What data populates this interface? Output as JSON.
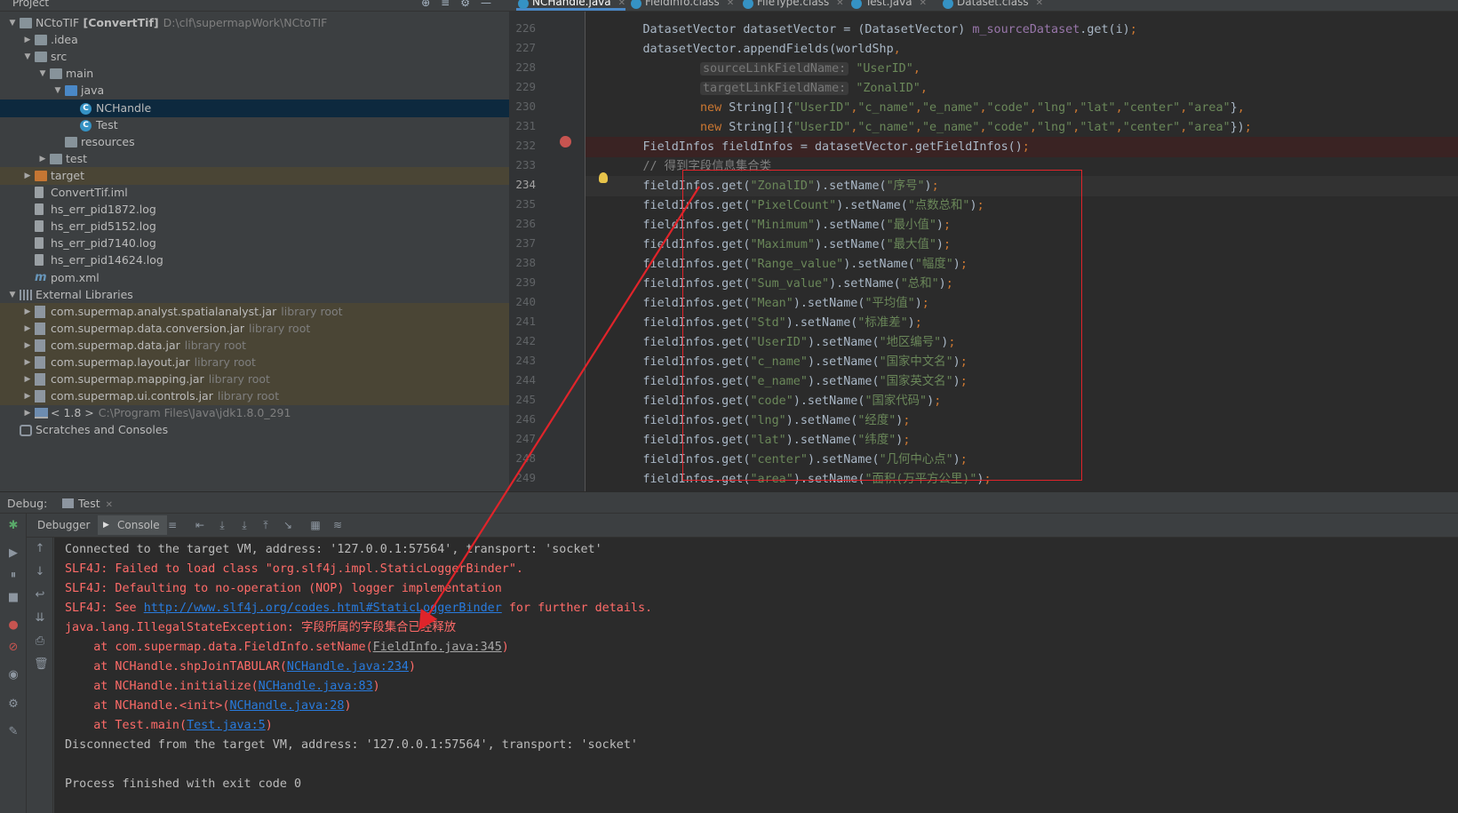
{
  "project": {
    "title": "Project",
    "tree": [
      {
        "depth": 0,
        "arrow": "▼",
        "icon": "folder",
        "label": "NCtoTIF",
        "bold_suffix": "[ConvertTif]",
        "hint": "D:\\clf\\supermapWork\\NCtoTIF"
      },
      {
        "depth": 1,
        "arrow": "▶",
        "icon": "folder",
        "label": ".idea"
      },
      {
        "depth": 1,
        "arrow": "▼",
        "icon": "folder",
        "label": "src"
      },
      {
        "depth": 2,
        "arrow": "▼",
        "icon": "folder",
        "label": "main"
      },
      {
        "depth": 3,
        "arrow": "▼",
        "icon": "folder-blue",
        "label": "java"
      },
      {
        "depth": 4,
        "arrow": "",
        "icon": "class",
        "label": "NCHandle",
        "selected": true
      },
      {
        "depth": 4,
        "arrow": "",
        "icon": "class",
        "label": "Test"
      },
      {
        "depth": 3,
        "arrow": "",
        "icon": "folder",
        "label": "resources"
      },
      {
        "depth": 2,
        "arrow": "▶",
        "icon": "folder",
        "label": "test"
      },
      {
        "depth": 1,
        "arrow": "▶",
        "icon": "folder-orange",
        "label": "target",
        "lib": true
      },
      {
        "depth": 1,
        "arrow": "",
        "icon": "file",
        "label": "ConvertTif.iml"
      },
      {
        "depth": 1,
        "arrow": "",
        "icon": "file",
        "label": "hs_err_pid1872.log"
      },
      {
        "depth": 1,
        "arrow": "",
        "icon": "file",
        "label": "hs_err_pid5152.log"
      },
      {
        "depth": 1,
        "arrow": "",
        "icon": "file",
        "label": "hs_err_pid7140.log"
      },
      {
        "depth": 1,
        "arrow": "",
        "icon": "file",
        "label": "hs_err_pid14624.log"
      },
      {
        "depth": 1,
        "arrow": "",
        "icon": "maven",
        "label": "pom.xml"
      },
      {
        "depth": 0,
        "arrow": "▼",
        "icon": "libs",
        "label": "External Libraries"
      },
      {
        "depth": 1,
        "arrow": "▶",
        "icon": "jar",
        "label": "com.supermap.analyst.spatialanalyst.jar",
        "hint": "library root",
        "lib": true
      },
      {
        "depth": 1,
        "arrow": "▶",
        "icon": "jar",
        "label": "com.supermap.data.conversion.jar",
        "hint": "library root",
        "lib": true
      },
      {
        "depth": 1,
        "arrow": "▶",
        "icon": "jar",
        "label": "com.supermap.data.jar",
        "hint": "library root",
        "lib": true
      },
      {
        "depth": 1,
        "arrow": "▶",
        "icon": "jar",
        "label": "com.supermap.layout.jar",
        "hint": "library root",
        "lib": true
      },
      {
        "depth": 1,
        "arrow": "▶",
        "icon": "jar",
        "label": "com.supermap.mapping.jar",
        "hint": "library root",
        "lib": true
      },
      {
        "depth": 1,
        "arrow": "▶",
        "icon": "jar",
        "label": "com.supermap.ui.controls.jar",
        "hint": "library root",
        "lib": true
      },
      {
        "depth": 1,
        "arrow": "▶",
        "icon": "jdk",
        "label": "< 1.8 >",
        "hint": "C:\\Program Files\\Java\\jdk1.8.0_291"
      },
      {
        "depth": 0,
        "arrow": "",
        "icon": "scratch",
        "label": "Scratches and Consoles"
      }
    ]
  },
  "editor": {
    "tabs": [
      {
        "label": "NCHandle.java",
        "active": true
      },
      {
        "label": "FieldInfo.class"
      },
      {
        "label": "FileType.class"
      },
      {
        "label": "Test.java"
      },
      {
        "label": "Dataset.class"
      }
    ],
    "lines": [
      {
        "num": "226",
        "code": "        DatasetVector datasetVector = (DatasetVector) m_sourceDataset.get(i);"
      },
      {
        "num": "227",
        "code": "        datasetVector.appendFields(worldShp,"
      },
      {
        "num": "228",
        "hint": "sourceLinkFieldName:",
        "str": "\"UserID\"",
        "tail": ","
      },
      {
        "num": "229",
        "hint": "targetLinkFieldName:",
        "str": "\"ZonalID\"",
        "tail": ","
      },
      {
        "num": "230",
        "code": "                new String[]{\"UserID\",\"c_name\",\"e_name\",\"code\",\"lng\",\"lat\",\"center\",\"area\"},"
      },
      {
        "num": "231",
        "code": "                new String[]{\"UserID\",\"c_name\",\"e_name\",\"code\",\"lng\",\"lat\",\"center\",\"area\"});"
      },
      {
        "num": "232",
        "code": "        FieldInfos fieldInfos = datasetVector.getFieldInfos();",
        "bp": true
      },
      {
        "num": "233",
        "code": "        // 得到字段信息集合类",
        "comment": true
      },
      {
        "num": "234",
        "code": "        fieldInfos.get(\"ZonalID\").setName(\"序号\");",
        "caret": true
      },
      {
        "num": "235",
        "code": "        fieldInfos.get(\"PixelCount\").setName(\"点数总和\");"
      },
      {
        "num": "236",
        "code": "        fieldInfos.get(\"Minimum\").setName(\"最小值\");"
      },
      {
        "num": "237",
        "code": "        fieldInfos.get(\"Maximum\").setName(\"最大值\");"
      },
      {
        "num": "238",
        "code": "        fieldInfos.get(\"Range_value\").setName(\"幅度\");"
      },
      {
        "num": "239",
        "code": "        fieldInfos.get(\"Sum_value\").setName(\"总和\");"
      },
      {
        "num": "240",
        "code": "        fieldInfos.get(\"Mean\").setName(\"平均值\");"
      },
      {
        "num": "241",
        "code": "        fieldInfos.get(\"Std\").setName(\"标准差\");"
      },
      {
        "num": "242",
        "code": "        fieldInfos.get(\"UserID\").setName(\"地区编号\");"
      },
      {
        "num": "243",
        "code": "        fieldInfos.get(\"c_name\").setName(\"国家中文名\");"
      },
      {
        "num": "244",
        "code": "        fieldInfos.get(\"e_name\").setName(\"国家英文名\");"
      },
      {
        "num": "245",
        "code": "        fieldInfos.get(\"code\").setName(\"国家代码\");"
      },
      {
        "num": "246",
        "code": "        fieldInfos.get(\"lng\").setName(\"经度\");"
      },
      {
        "num": "247",
        "code": "        fieldInfos.get(\"lat\").setName(\"纬度\");"
      },
      {
        "num": "248",
        "code": "        fieldInfos.get(\"center\").setName(\"几何中心点\");"
      },
      {
        "num": "249",
        "code": "        fieldInfos.get(\"area\").setName(\"面积(万平方公里)\");"
      }
    ]
  },
  "debug": {
    "label": "Debug:",
    "tab": "Test",
    "debugger_tab": "Debugger",
    "console_tab": "Console",
    "console": [
      {
        "kind": "norm",
        "text": "Connected to the target VM, address: '127.0.0.1:57564', transport: 'socket'"
      },
      {
        "kind": "err",
        "text": "SLF4J: Failed to load class \"org.slf4j.impl.StaticLoggerBinder\"."
      },
      {
        "kind": "err",
        "text": "SLF4J: Defaulting to no-operation (NOP) logger implementation"
      },
      {
        "kind": "err",
        "parts": [
          [
            "SLF4J: See ",
            "t"
          ],
          [
            "http://www.slf4j.org/codes.html#StaticLoggerBinder",
            "link"
          ],
          [
            " for further details.",
            "t"
          ]
        ]
      },
      {
        "kind": "err",
        "text": "java.lang.IllegalStateException: 字段所属的字段集合已经释放"
      },
      {
        "kind": "err",
        "parts": [
          [
            "    at com.supermap.data.FieldInfo.setName(",
            "t"
          ],
          [
            "FieldInfo.java:345",
            "grey"
          ],
          [
            ")",
            "t"
          ]
        ]
      },
      {
        "kind": "err",
        "parts": [
          [
            "    at NCHandle.shpJoinTABULAR(",
            "t"
          ],
          [
            "NCHandle.java:234",
            "link"
          ],
          [
            ")",
            "t"
          ]
        ]
      },
      {
        "kind": "err",
        "parts": [
          [
            "    at NCHandle.initialize(",
            "t"
          ],
          [
            "NCHandle.java:83",
            "link"
          ],
          [
            ")",
            "t"
          ]
        ]
      },
      {
        "kind": "err",
        "parts": [
          [
            "    at NCHandle.<init>(",
            "t"
          ],
          [
            "NCHandle.java:28",
            "link"
          ],
          [
            ")",
            "t"
          ]
        ]
      },
      {
        "kind": "err",
        "parts": [
          [
            "    at Test.main(",
            "t"
          ],
          [
            "Test.java:5",
            "link"
          ],
          [
            ")",
            "t"
          ]
        ]
      },
      {
        "kind": "norm",
        "text": "Disconnected from the target VM, address: '127.0.0.1:57564', transport: 'socket'"
      },
      {
        "kind": "norm",
        "text": ""
      },
      {
        "kind": "norm",
        "text": "Process finished with exit code 0"
      }
    ]
  },
  "colors": {
    "annotation_red": "#e0242a",
    "accent": "#4a88c7"
  }
}
